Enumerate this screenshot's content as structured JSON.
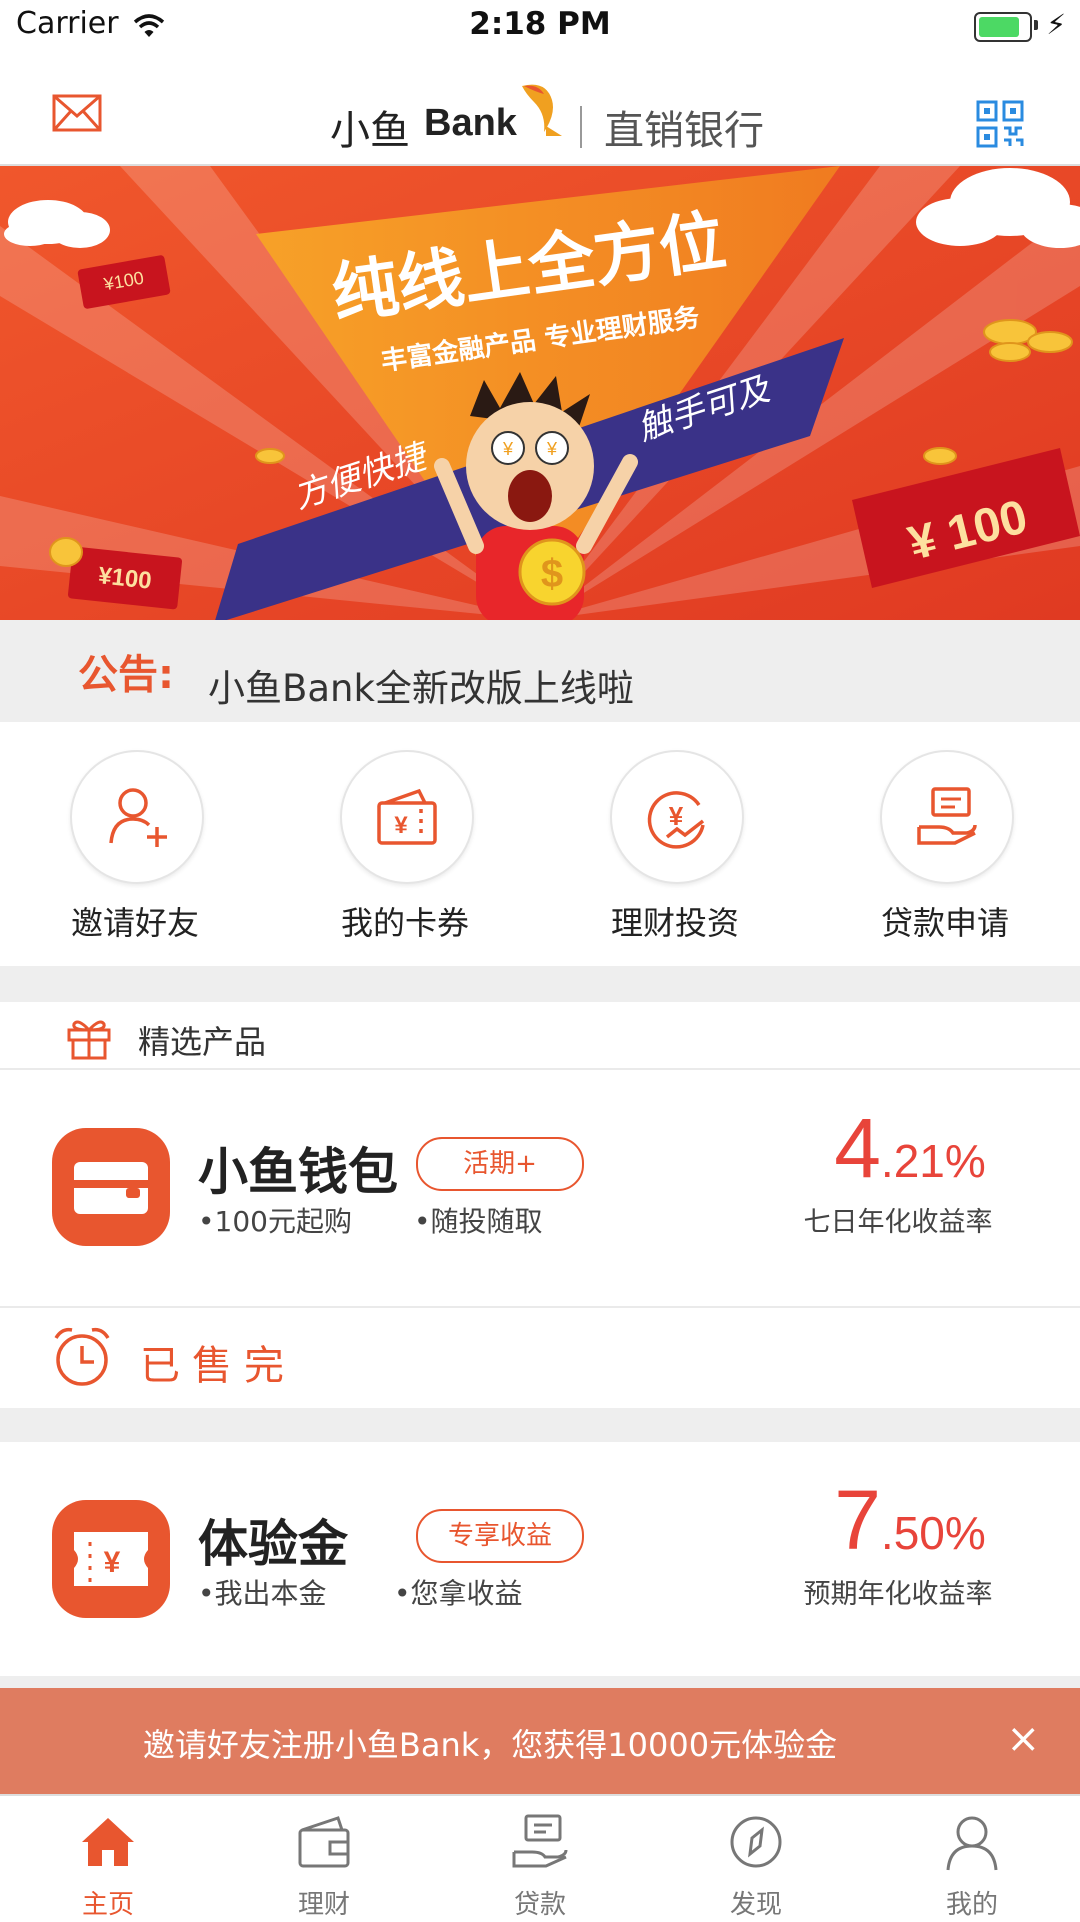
{
  "status_bar": {
    "carrier": "Carrier",
    "time": "2:18 PM"
  },
  "header": {
    "logo_cn": "小鱼",
    "logo_en": "Bank",
    "subtitle": "直销银行"
  },
  "banner": {
    "headline": "纯线上全方位",
    "subline": "丰富金融产品 专业理财服务",
    "ribbon_left": "方便快捷",
    "ribbon_right": "触手可及",
    "ticket_small": "¥100",
    "ticket_left": "¥100",
    "ticket_big": "¥ 100",
    "coin_symbol": "$"
  },
  "notice": {
    "label": "公告:",
    "text": "小鱼Bank全新改版上线啦"
  },
  "quick_actions": [
    {
      "label": "邀请好友",
      "icon": "invite-friend-icon"
    },
    {
      "label": "我的卡券",
      "icon": "coupon-icon"
    },
    {
      "label": "理财投资",
      "icon": "investment-icon"
    },
    {
      "label": "贷款申请",
      "icon": "loan-icon"
    }
  ],
  "featured": {
    "title": "精选产品"
  },
  "products": [
    {
      "name": "小鱼钱包",
      "tag": "活期+",
      "feature1": "•100元起购",
      "feature2": "•随投随取",
      "rate_int": "4",
      "rate_dec": ".21%",
      "rate_label": "七日年化收益率"
    },
    {
      "name": "体验金",
      "tag": "专享收益",
      "feature1": "•我出本金",
      "feature2": "•您拿收益",
      "rate_int": "7",
      "rate_dec": ".50%",
      "rate_label": "预期年化收益率"
    }
  ],
  "soldout": {
    "text": "已售完"
  },
  "promo": {
    "text": "邀请好友注册小鱼Bank，您获得10000元体验金",
    "close": "×"
  },
  "tabs": [
    {
      "label": "主页",
      "icon": "home-icon",
      "active": true
    },
    {
      "label": "理财",
      "icon": "wallet-icon",
      "active": false
    },
    {
      "label": "贷款",
      "icon": "loan-tab-icon",
      "active": false
    },
    {
      "label": "发现",
      "icon": "compass-icon",
      "active": false
    },
    {
      "label": "我的",
      "icon": "profile-icon",
      "active": false
    }
  ],
  "colors": {
    "accent": "#e8562f",
    "rate": "#e8443a",
    "promo_bg": "#df7c60",
    "gap": "#eeeeee"
  }
}
